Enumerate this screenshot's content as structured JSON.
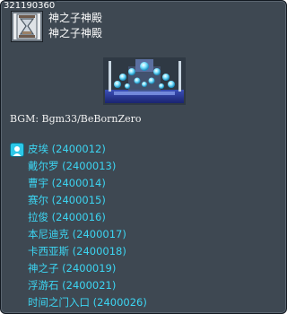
{
  "map": {
    "id": "321190360",
    "title_line1": "神之子神殿",
    "title_line2": "神之子神殿"
  },
  "bgm": "BGM: Bgm33/BeBornZero",
  "npcs": [
    {
      "name": "皮埃",
      "code": "(2400012)"
    },
    {
      "name": "戴尔罗",
      "code": "(2400013)"
    },
    {
      "name": "曹宇",
      "code": "(2400014)"
    },
    {
      "name": "赛尔",
      "code": "(2400015)"
    },
    {
      "name": "拉俊",
      "code": "(2400016)"
    },
    {
      "name": "本尼迪克",
      "code": "(2400017)"
    },
    {
      "name": "卡西亚斯",
      "code": "(2400018)"
    },
    {
      "name": "神之子",
      "code": "(2400019)"
    },
    {
      "name": "浮游石",
      "code": "(2400021)"
    },
    {
      "name": "时间之门入口",
      "code": "(2400026)"
    }
  ],
  "icons": {
    "map": "hourglass-icon",
    "npc": "npc-person-icon"
  },
  "colors": {
    "panel": "#3e4852",
    "npc_text": "#3cd5f2",
    "title_text": "#ffffff"
  }
}
